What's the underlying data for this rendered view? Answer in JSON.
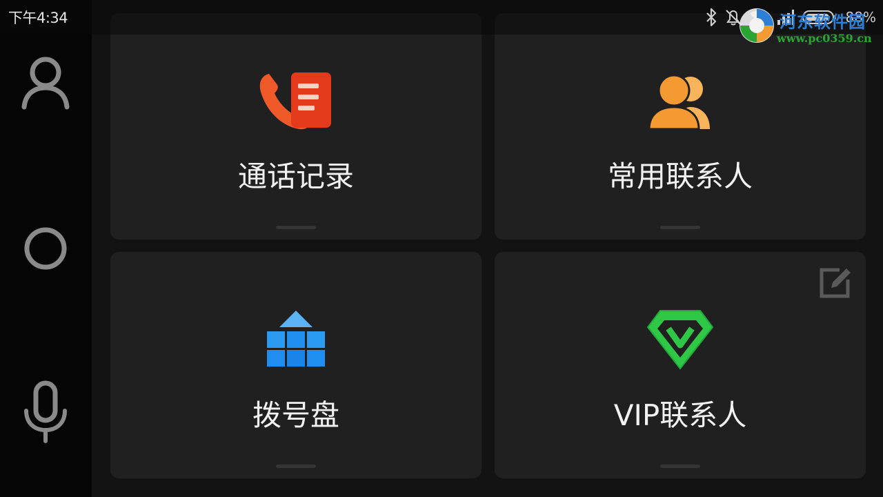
{
  "status_bar": {
    "time": "下午4:34",
    "battery_percent": "88%",
    "icons": [
      "bluetooth-icon",
      "notifications-off-icon",
      "wifi-icon",
      "signal-icon",
      "battery-icon"
    ]
  },
  "watermark": {
    "title": "河东软件园",
    "url": "www.pc0359.cn"
  },
  "side_nav": {
    "items": [
      {
        "icon": "person-icon"
      },
      {
        "icon": "home-circle-icon"
      },
      {
        "icon": "microphone-icon"
      }
    ]
  },
  "tiles": [
    {
      "label": "通话记录",
      "icon": "call-log-icon",
      "color": "#e8401c"
    },
    {
      "label": "常用联系人",
      "icon": "frequent-contacts-icon",
      "color": "#f39a32"
    },
    {
      "label": "拨号盘",
      "icon": "dialpad-icon",
      "color": "#1f8ef0"
    },
    {
      "label": "VIP联系人",
      "icon": "vip-diamond-icon",
      "color": "#2fc846",
      "edit_icon": "edit-icon"
    }
  ]
}
